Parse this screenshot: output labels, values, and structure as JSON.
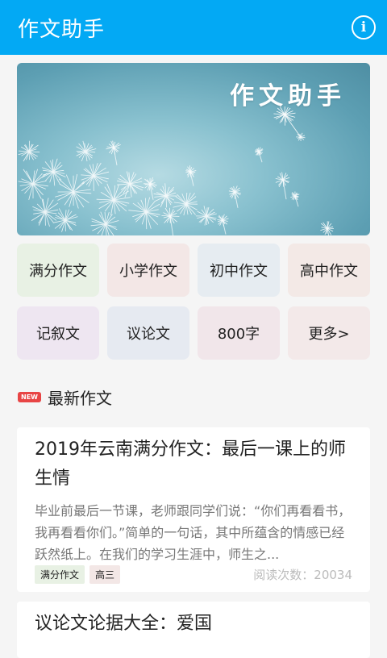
{
  "appbar": {
    "title": "作文助手",
    "info_icon": "info-icon",
    "color": "#03a9f4"
  },
  "banner": {
    "title": "作文助手",
    "image": "dandelion-seeds-illustration"
  },
  "categories": [
    {
      "label": "满分作文",
      "color": "#e8f1e4"
    },
    {
      "label": "小学作文",
      "color": "#f3e7e6"
    },
    {
      "label": "初中作文",
      "color": "#e6ecf1"
    },
    {
      "label": "高中作文",
      "color": "#f3e9e6"
    },
    {
      "label": "记叙文",
      "color": "#eee6f1"
    },
    {
      "label": "议论文",
      "color": "#e6eaf1"
    },
    {
      "label": "800字",
      "color": "#f1e6ea"
    },
    {
      "label": "更多>",
      "color": "#f3e9e9"
    }
  ],
  "section": {
    "badge": "NEW",
    "title": "最新作文"
  },
  "articles": [
    {
      "title": "2019年云南满分作文：最后一课上的师生情",
      "excerpt": "毕业前最后一节课，老师跟同学们说：“你们再看看书，我再看看你们。”简单的一句话，其中所蕴含的情感已经跃然纸上。在我们的学习生涯中，师生之...",
      "tags": [
        {
          "label": "满分作文",
          "color": "#e8f1e4"
        },
        {
          "label": "高三",
          "color": "#f3e7e6"
        }
      ],
      "views": "阅读次数：20034"
    },
    {
      "title": "议论文论据大全：爱国"
    }
  ]
}
